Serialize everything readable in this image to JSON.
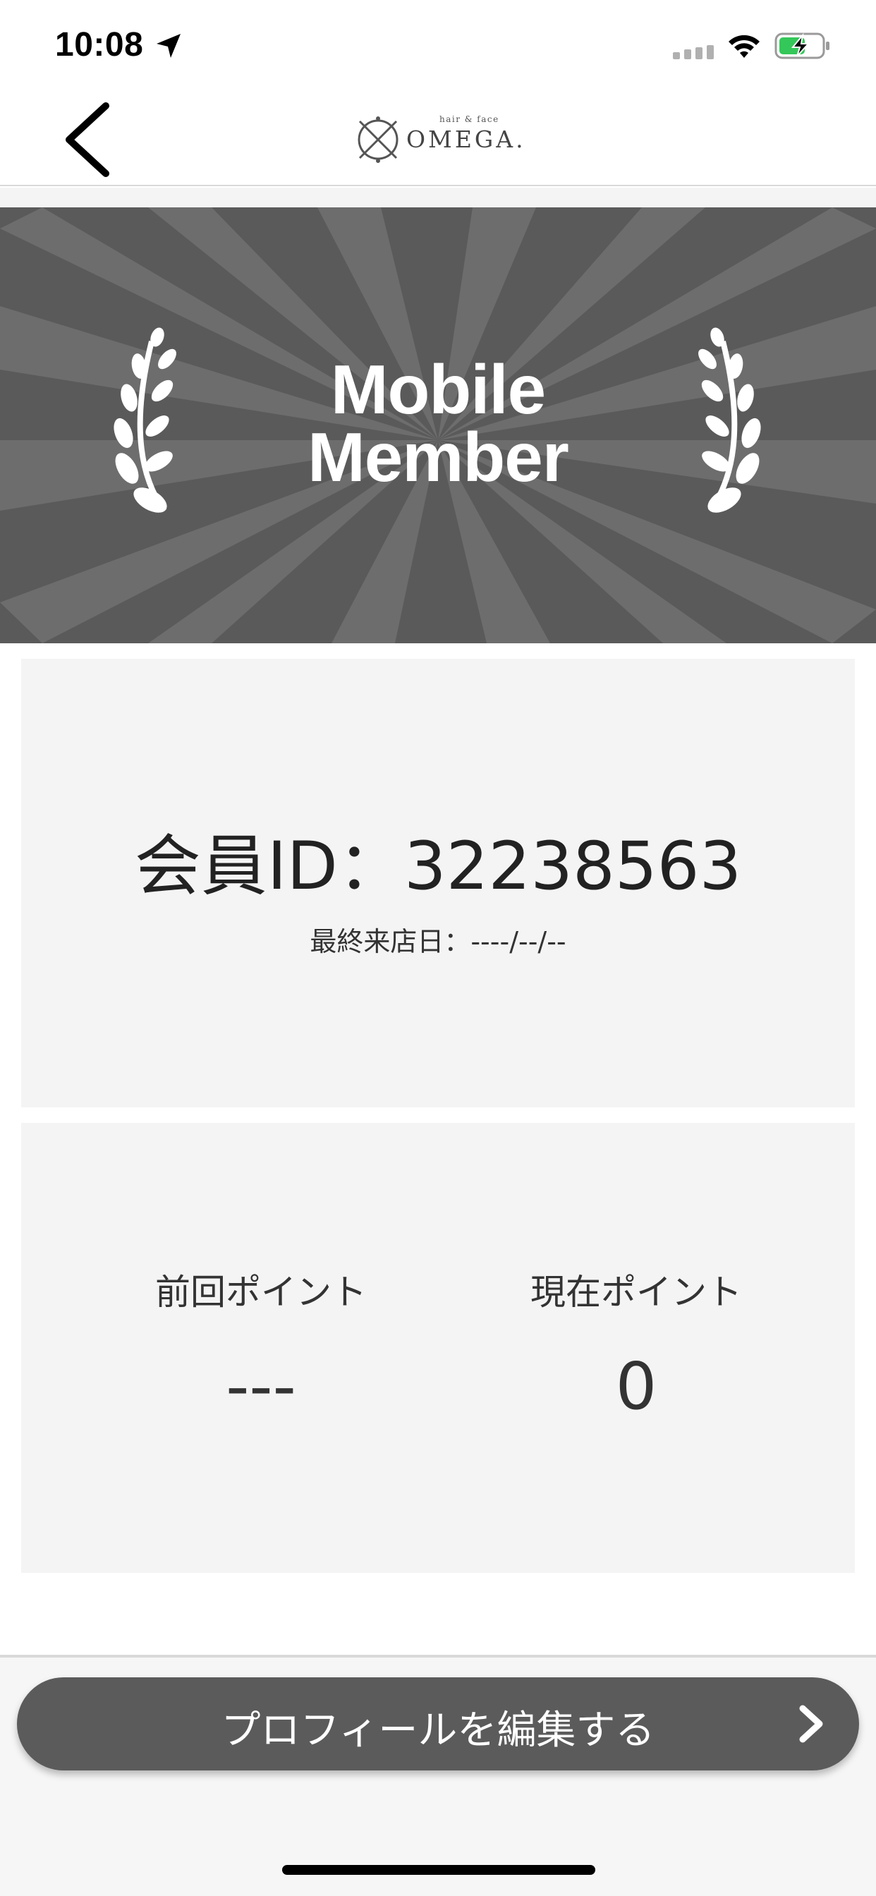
{
  "status_bar": {
    "time": "10:08"
  },
  "nav": {
    "logo_sub": "hair & face",
    "logo_main": "OMEGA."
  },
  "banner": {
    "line1": "Mobile",
    "line2": "Member"
  },
  "member": {
    "id_text": "会員ID：32238563",
    "last_visit": "最終来店日：----/--/--"
  },
  "points": {
    "previous_label": "前回ポイント",
    "previous_value": "---",
    "current_label": "現在ポイント",
    "current_value": "0"
  },
  "footer": {
    "edit_profile_label": "プロフィールを編集する"
  },
  "colors": {
    "banner_bg": "#5a5a5a",
    "banner_ray": "#6d6d6d",
    "card_bg": "#f4f4f4",
    "button_bg": "#5b5b5b",
    "battery_green": "#34c759"
  }
}
